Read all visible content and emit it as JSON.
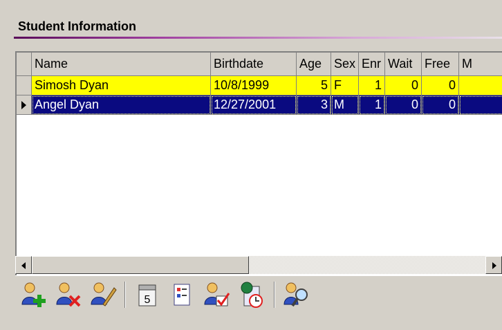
{
  "section": {
    "title": "Student Information"
  },
  "grid": {
    "columns": [
      "Name",
      "Birthdate",
      "Age",
      "Sex",
      "Enr",
      "Wait",
      "Free",
      "M"
    ],
    "rows": [
      {
        "name": "Simosh Dyan",
        "birthdate": "10/8/1999",
        "age": "5",
        "sex": "F",
        "enr": "1",
        "wait": "0",
        "free": "0",
        "m": ""
      },
      {
        "name": "Angel Dyan",
        "birthdate": "12/27/2001",
        "age": "3",
        "sex": "M",
        "enr": "1",
        "wait": "0",
        "free": "0",
        "m": ""
      }
    ],
    "selected_row": 1,
    "row_colors": [
      "#ffff00",
      "#0a0a80"
    ]
  },
  "toolbar": {
    "buttons": [
      {
        "icon": "add-student-icon"
      },
      {
        "icon": "delete-student-icon"
      },
      {
        "icon": "edit-student-icon"
      },
      {
        "icon": "calendar-icon",
        "calendar_day": "5"
      },
      {
        "icon": "checklist-icon"
      },
      {
        "icon": "enroll-student-icon"
      },
      {
        "icon": "billing-schedule-icon"
      },
      {
        "icon": "search-student-icon"
      }
    ]
  },
  "colors": {
    "accent": "#8a2a8a",
    "selection": "#0a0a80",
    "highlight": "#ffff00"
  }
}
